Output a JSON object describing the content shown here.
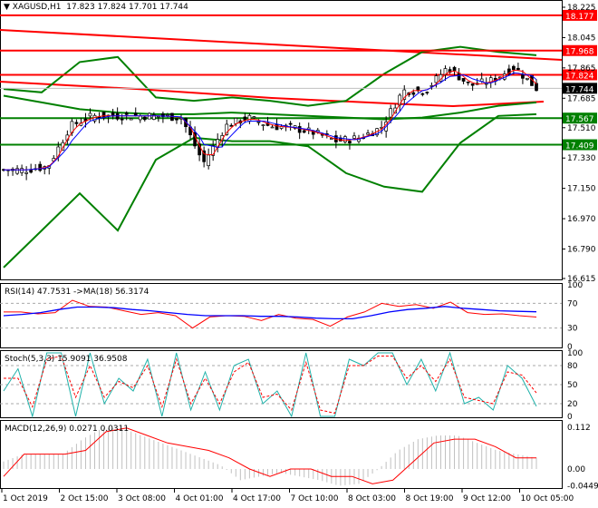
{
  "header": {
    "symbol": "XAGUSD,H1",
    "open": "17.823",
    "high": "17.824",
    "low": "17.701",
    "close": "17.744"
  },
  "levels": [
    {
      "value": "18.177",
      "color": "#ff0000"
    },
    {
      "value": "17.968",
      "color": "#ff0000"
    },
    {
      "value": "17.824",
      "color": "#ff0000"
    },
    {
      "value": "17.567",
      "color": "#008000"
    },
    {
      "value": "17.409",
      "color": "#008000"
    }
  ],
  "current_price": "17.744",
  "price_ticks": [
    "18.225",
    "18.045",
    "17.865",
    "17.685",
    "17.510",
    "17.330",
    "17.150",
    "16.970",
    "16.790",
    "16.615"
  ],
  "rsi": {
    "label": "RSI(14) 47.7531  ->MA(18) 56.3174",
    "ticks": [
      "100",
      "70",
      "30",
      "0"
    ]
  },
  "stoch": {
    "label": "Stoch(5,3,3) 15.9091 36.9508",
    "ticks": [
      "100",
      "80",
      "50",
      "20",
      "0"
    ]
  },
  "macd": {
    "label": "MACD(12,26,9) 0.0271 0.0311",
    "ticks": [
      "0.112",
      "0.00",
      "-0.0449"
    ]
  },
  "time_labels": [
    "1 Oct 2019",
    "2 Oct 15:00",
    "3 Oct 08:00",
    "4 Oct 01:00",
    "4 Oct 17:00",
    "7 Oct 10:00",
    "8 Oct 03:00",
    "8 Oct 19:00",
    "9 Oct 12:00",
    "10 Oct 05:00"
  ],
  "chart_data": {
    "type": "candlestick",
    "ylim": [
      16.615,
      18.225
    ],
    "closes": [
      17.26,
      17.26,
      17.28,
      17.52,
      17.58,
      17.58,
      17.58,
      17.58,
      17.57,
      17.3,
      17.52,
      17.57,
      17.52,
      17.51,
      17.48,
      17.43,
      17.45,
      17.51,
      17.73,
      17.73,
      17.87,
      17.76,
      17.79,
      17.87,
      17.744
    ],
    "bb_upper": [
      17.74,
      17.72,
      17.9,
      17.93,
      17.69,
      17.67,
      17.69,
      17.67,
      17.64,
      17.67,
      17.83,
      17.96,
      17.99,
      17.96,
      17.94
    ],
    "bb_middle": [
      17.7,
      17.66,
      17.62,
      17.6,
      17.59,
      17.59,
      17.6,
      17.59,
      17.58,
      17.57,
      17.56,
      17.57,
      17.6,
      17.64,
      17.66
    ],
    "bb_lower": [
      16.68,
      16.9,
      17.12,
      16.9,
      17.32,
      17.45,
      17.43,
      17.43,
      17.4,
      17.24,
      17.16,
      17.13,
      17.42,
      17.58,
      17.59
    ],
    "rsi": [
      56,
      56,
      53,
      55,
      75,
      65,
      64,
      58,
      52,
      55,
      50,
      30,
      48,
      50,
      49,
      42,
      52,
      46,
      44,
      33,
      48,
      56,
      70,
      65,
      68,
      62,
      72,
      55,
      52,
      53,
      50,
      47.75
    ],
    "rsi_ma": [
      50,
      52,
      55,
      60,
      64,
      64,
      63,
      60,
      58,
      55,
      52,
      50,
      50,
      50,
      49,
      49,
      48,
      46,
      45,
      45,
      50,
      56,
      60,
      62,
      65,
      62,
      60,
      58,
      57,
      56.3
    ],
    "stoch_k": [
      40,
      75,
      0,
      100,
      100,
      0,
      100,
      20,
      60,
      40,
      90,
      0,
      100,
      10,
      70,
      10,
      80,
      90,
      20,
      40,
      0,
      100,
      0,
      0,
      90,
      80,
      100,
      100,
      50,
      90,
      40,
      100,
      20,
      30,
      10,
      80,
      60,
      15.9
    ],
    "stoch_d": [
      60,
      60,
      15,
      90,
      95,
      30,
      80,
      30,
      55,
      45,
      80,
      15,
      90,
      20,
      60,
      20,
      70,
      85,
      30,
      35,
      10,
      85,
      10,
      5,
      80,
      80,
      95,
      95,
      60,
      80,
      55,
      90,
      30,
      25,
      20,
      70,
      65,
      36.95
    ],
    "macd_hist": [
      0.02,
      0.04,
      0.04,
      0.04,
      0.08,
      0.11,
      0.11,
      0.09,
      0.07,
      0.05,
      0.03,
      0.01,
      -0.03,
      -0.02,
      -0.01,
      -0.02,
      -0.03,
      -0.045,
      -0.04,
      0.0,
      0.05,
      0.08,
      0.09,
      0.09,
      0.07,
      0.05,
      0.04,
      0.03
    ],
    "macd_signal": [
      -0.02,
      0.04,
      0.04,
      0.04,
      0.05,
      0.1,
      0.11,
      0.09,
      0.07,
      0.06,
      0.05,
      0.03,
      0.0,
      -0.02,
      0.0,
      0.0,
      -0.02,
      -0.02,
      -0.04,
      -0.03,
      0.02,
      0.07,
      0.08,
      0.08,
      0.06,
      0.03,
      0.03
    ]
  }
}
